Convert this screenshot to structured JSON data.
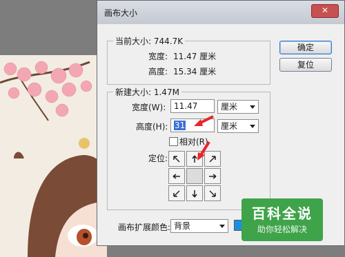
{
  "dialog": {
    "title": "画布大小",
    "close_symbol": "✕",
    "current": {
      "group_label": "当前大小: 744.7K",
      "width_label": "宽度:",
      "width_value": "11.47 厘米",
      "height_label": "高度:",
      "height_value": "15.34 厘米"
    },
    "new": {
      "group_label": "新建大小: 1.47M",
      "width_label": "宽度(W):",
      "width_value": "11.47",
      "width_unit": "厘米",
      "height_label": "高度(H):",
      "height_value": "31",
      "height_unit": "厘米",
      "relative_label": "相对(R)",
      "anchor_label": "定位:"
    },
    "buttons": {
      "ok": "确定",
      "reset": "复位"
    },
    "extension": {
      "label": "画布扩展颜色:",
      "value": "背景",
      "swatch_color": "#1b8fe6"
    }
  },
  "watermark": {
    "title": "百科全说",
    "subtitle": "助你轻松解决"
  },
  "colors": {
    "annotation_arrow": "#e8262a",
    "selection": "#3a6fd8"
  }
}
